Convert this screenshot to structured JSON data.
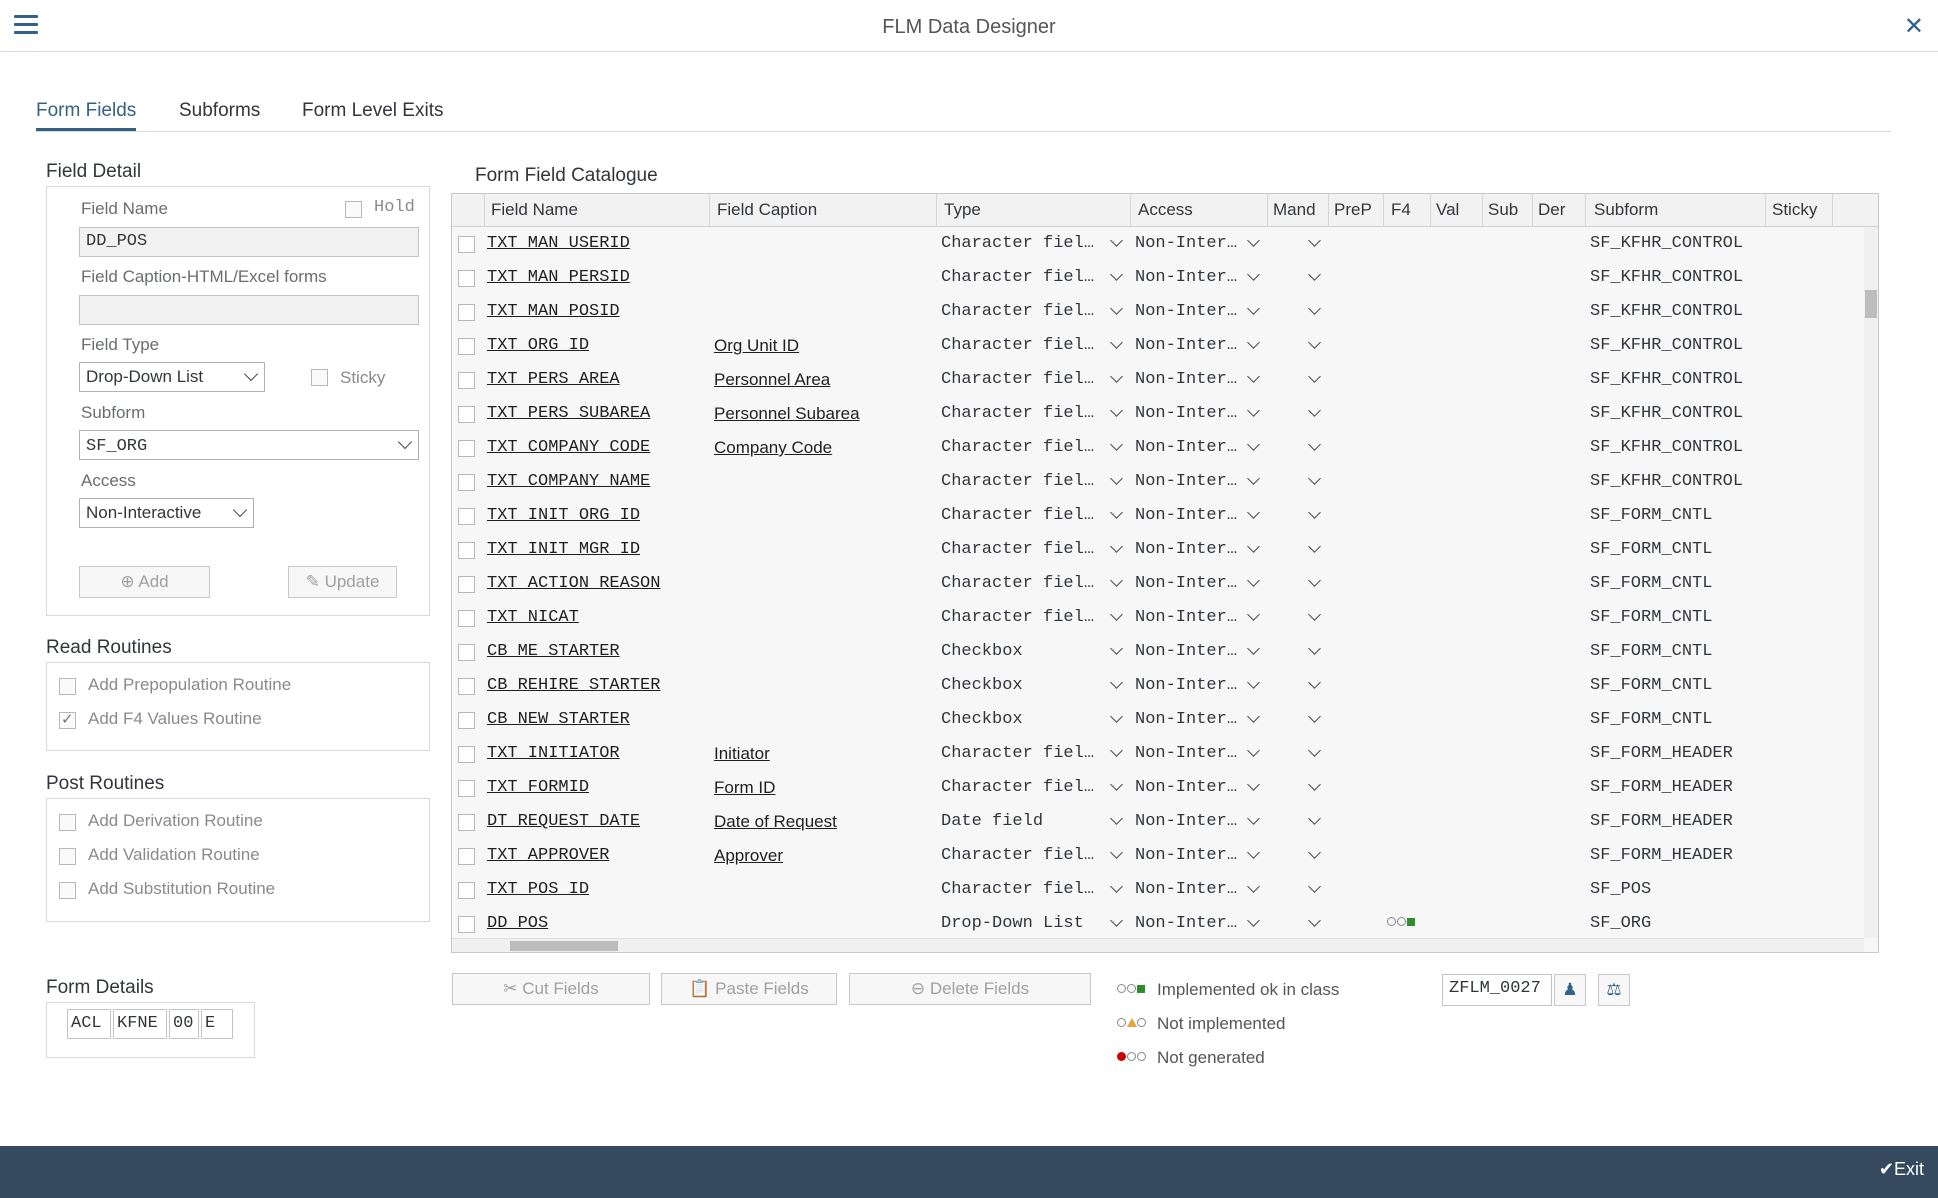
{
  "window": {
    "title": "FLM Data Designer"
  },
  "tabs": [
    "Form Fields",
    "Subforms",
    "Form Level Exits"
  ],
  "field_detail": {
    "title": "Field Detail",
    "field_name_label": "Field Name",
    "hold_label": "Hold",
    "field_name_value": "DD_POS",
    "caption_label": "Field Caption-HTML/Excel forms",
    "caption_value": "",
    "field_type_label": "Field Type",
    "field_type_value": "Drop-Down List",
    "sticky_label": "Sticky",
    "subform_label": "Subform",
    "subform_value": "SF_ORG",
    "access_label": "Access",
    "access_value": "Non-Interactive",
    "add_button": "Add",
    "update_button": "Update"
  },
  "read_routines": {
    "title": "Read Routines",
    "items": [
      {
        "label": "Add Prepopulation Routine",
        "checked": false
      },
      {
        "label": "Add F4 Values Routine",
        "checked": true
      }
    ]
  },
  "post_routines": {
    "title": "Post Routines",
    "items": [
      {
        "label": "Add Derivation Routine",
        "checked": false
      },
      {
        "label": "Add Validation Routine",
        "checked": false
      },
      {
        "label": "Add Substitution Routine",
        "checked": false
      }
    ]
  },
  "form_details": {
    "title": "Form Details",
    "parts": [
      "ACL",
      "KFNE",
      "00",
      "E"
    ]
  },
  "catalogue": {
    "title": "Form Field Catalogue",
    "columns": [
      "Field Name",
      "Field Caption",
      "Type",
      "Access",
      "Mand",
      "PreP",
      "F4",
      "Val",
      "Sub",
      "Der",
      "Subform",
      "Sticky"
    ],
    "rows": [
      {
        "name": "TXT_MAN_USERID",
        "caption": "",
        "type": "Character fiel…",
        "access": "Non-Inter…",
        "subform": "SF_KFHR_CONTROL"
      },
      {
        "name": "TXT_MAN_PERSID",
        "caption": "",
        "type": "Character fiel…",
        "access": "Non-Inter…",
        "subform": "SF_KFHR_CONTROL"
      },
      {
        "name": "TXT_MAN_POSID",
        "caption": "",
        "type": "Character fiel…",
        "access": "Non-Inter…",
        "subform": "SF_KFHR_CONTROL"
      },
      {
        "name": "TXT_ORG_ID",
        "caption": "Org Unit ID",
        "type": "Character fiel…",
        "access": "Non-Inter…",
        "subform": "SF_KFHR_CONTROL"
      },
      {
        "name": "TXT_PERS_AREA",
        "caption": "Personnel Area",
        "type": "Character fiel…",
        "access": "Non-Inter…",
        "subform": "SF_KFHR_CONTROL"
      },
      {
        "name": "TXT_PERS_SUBAREA",
        "caption": "Personnel Subarea",
        "type": "Character fiel…",
        "access": "Non-Inter…",
        "subform": "SF_KFHR_CONTROL"
      },
      {
        "name": "TXT_COMPANY_CODE",
        "caption": "Company Code",
        "type": "Character fiel…",
        "access": "Non-Inter…",
        "subform": "SF_KFHR_CONTROL"
      },
      {
        "name": "TXT_COMPANY_NAME",
        "caption": "",
        "type": "Character fiel…",
        "access": "Non-Inter…",
        "subform": "SF_KFHR_CONTROL"
      },
      {
        "name": "TXT_INIT_ORG_ID",
        "caption": "",
        "type": "Character fiel…",
        "access": "Non-Inter…",
        "subform": "SF_FORM_CNTL"
      },
      {
        "name": "TXT_INIT_MGR_ID",
        "caption": "",
        "type": "Character fiel…",
        "access": "Non-Inter…",
        "subform": "SF_FORM_CNTL"
      },
      {
        "name": "TXT_ACTION_REASON",
        "caption": "",
        "type": "Character fiel…",
        "access": "Non-Inter…",
        "subform": "SF_FORM_CNTL"
      },
      {
        "name": "TXT_NICAT",
        "caption": "",
        "type": "Character fiel…",
        "access": "Non-Inter…",
        "subform": "SF_FORM_CNTL"
      },
      {
        "name": "CB_ME_STARTER",
        "caption": "",
        "type": "Checkbox",
        "access": "Non-Inter…",
        "subform": "SF_FORM_CNTL"
      },
      {
        "name": "CB_REHIRE_STARTER",
        "caption": "",
        "type": "Checkbox",
        "access": "Non-Inter…",
        "subform": "SF_FORM_CNTL"
      },
      {
        "name": "CB_NEW_STARTER",
        "caption": "",
        "type": "Checkbox",
        "access": "Non-Inter…",
        "subform": "SF_FORM_CNTL"
      },
      {
        "name": "TXT_INITIATOR",
        "caption": "Initiator",
        "type": "Character fiel…",
        "access": "Non-Inter…",
        "subform": "SF_FORM_HEADER"
      },
      {
        "name": "TXT_FORMID",
        "caption": "Form ID",
        "type": "Character fiel…",
        "access": "Non-Inter…",
        "subform": "SF_FORM_HEADER"
      },
      {
        "name": "DT_REQUEST_DATE",
        "caption": "Date of Request",
        "type": "Date field",
        "access": "Non-Inter…",
        "subform": "SF_FORM_HEADER"
      },
      {
        "name": "TXT_APPROVER",
        "caption": "Approver",
        "type": "Character fiel…",
        "access": "Non-Inter…",
        "subform": "SF_FORM_HEADER"
      },
      {
        "name": "TXT_POS_ID",
        "caption": "",
        "type": "Character fiel…",
        "access": "Non-Inter…",
        "subform": "SF_POS"
      },
      {
        "name": "DD_POS",
        "caption": "",
        "type": "Drop-Down List",
        "access": "Non-Inter…",
        "subform": "SF_ORG",
        "f4_status": "implemented"
      }
    ]
  },
  "actions": {
    "cut": "Cut Fields",
    "paste": "Paste Fields",
    "delete": "Delete Fields"
  },
  "legend": {
    "implemented": "Implemented ok in class",
    "not_implemented": "Not implemented",
    "not_generated": "Not generated"
  },
  "class_name": "ZFLM_0027",
  "footer": {
    "exit": "Exit"
  },
  "colors": {
    "accent": "#346187",
    "footer": "#354a5f",
    "green": "#2e8b2e",
    "orange": "#e8a33d",
    "red": "#cc0000"
  }
}
